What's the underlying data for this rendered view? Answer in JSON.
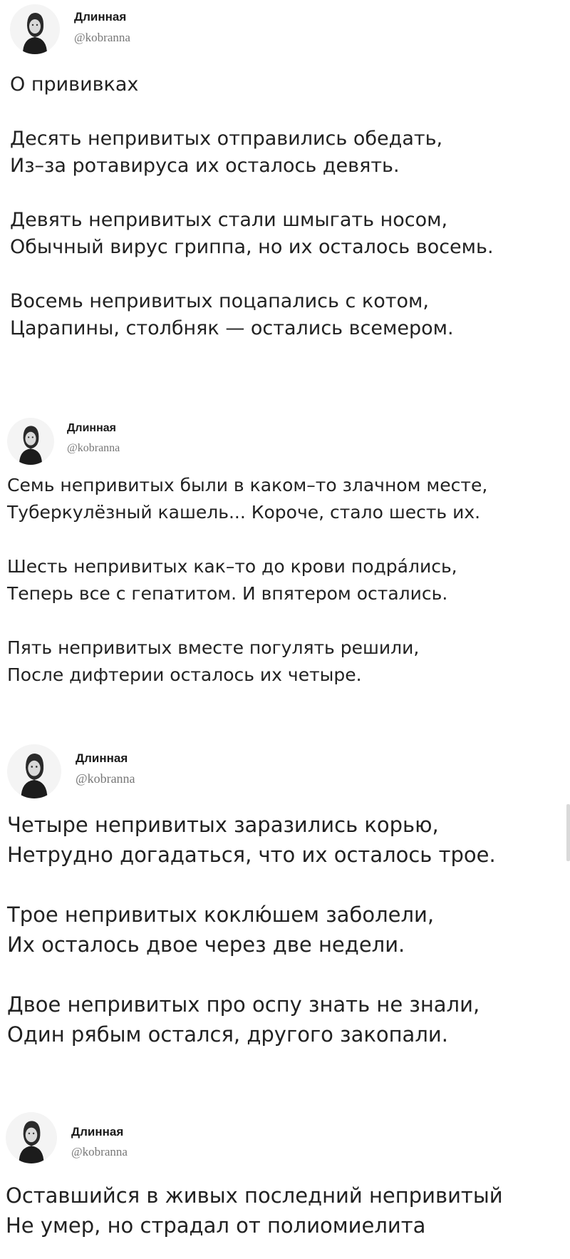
{
  "tweets": [
    {
      "author": {
        "name": "Длинная",
        "handle": "@kobranna",
        "avatar_icon": "profile-photo-avatar"
      },
      "stanzas": [
        "О прививках",
        "Десять непривитых отправились обедать,\nИз–за ротавируса их осталось девять.",
        "Девять непривитых стали шмыгать носом,\nОбычный вирус гриппа, но их осталось восемь.",
        "Восемь непривитых поцапались с котом,\nЦарапины, столбняк — остались всемером."
      ]
    },
    {
      "author": {
        "name": "Длинная",
        "handle": "@kobranna",
        "avatar_icon": "profile-photo-avatar"
      },
      "stanzas": [
        "Семь непривитых были в каком–то злачном месте,\nТуберкулёзный кашель... Короче, стало шесть их.",
        "Шесть непривитых как–то до крови подрáлись,\nТеперь все с гепатитом. И впятером остались.",
        "Пять непривитых вместе погулять решили,\nПосле дифтерии осталось их четыре."
      ]
    },
    {
      "author": {
        "name": "Длинная",
        "handle": "@kobranna",
        "avatar_icon": "profile-photo-avatar"
      },
      "stanzas": [
        "Четыре непривитых заразились корью,\nНетрудно догадаться, что их осталось трое.",
        "Трое непривитых коклю́шем заболели,\nИх осталось двое через две недели.",
        "Двое непривитых про оспу знать не знали,\nОдин рябым остался, другого закопали."
      ]
    },
    {
      "author": {
        "name": "Длинная",
        "handle": "@kobranna",
        "avatar_icon": "profile-photo-avatar"
      },
      "stanzas": [
        "Оставшийся в живых последний непривитый\nНе умер, но страдал от полиомиелита"
      ]
    }
  ],
  "colors": {
    "background": "#ffffff",
    "text": "#222222",
    "handle": "#777777"
  }
}
